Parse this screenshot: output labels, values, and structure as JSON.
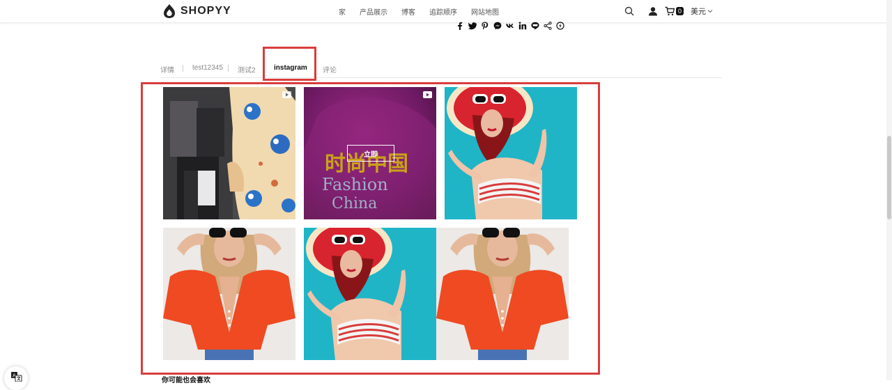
{
  "header": {
    "logo_text": "SHOPYY",
    "nav": [
      "家",
      "产品展示",
      "博客",
      "追踪顺序",
      "网站地图"
    ],
    "cart_count": "0",
    "currency": "美元"
  },
  "share": {
    "icons": [
      "facebook-icon",
      "twitter-icon",
      "pinterest-icon",
      "messenger-icon",
      "vk-icon",
      "linkedin-icon",
      "line-icon",
      "share-icon",
      "more-icon"
    ]
  },
  "tabs": [
    {
      "label": "详情",
      "active": false
    },
    {
      "label": "test12345",
      "active": false
    },
    {
      "label": "测试2",
      "active": false
    },
    {
      "label": "instagram",
      "active": true
    },
    {
      "label": "评论",
      "active": false
    }
  ],
  "instagram": {
    "overlay_button": "立即",
    "video_caption_cn": "时尚中国",
    "video_caption_en1": "Fashion",
    "video_caption_en2": "China"
  },
  "section": {
    "also_like": "你可能也会喜欢"
  },
  "colors": {
    "highlight": "#d93c3c",
    "teal": "#1fb5c7",
    "red_top": "#ef4a22"
  }
}
